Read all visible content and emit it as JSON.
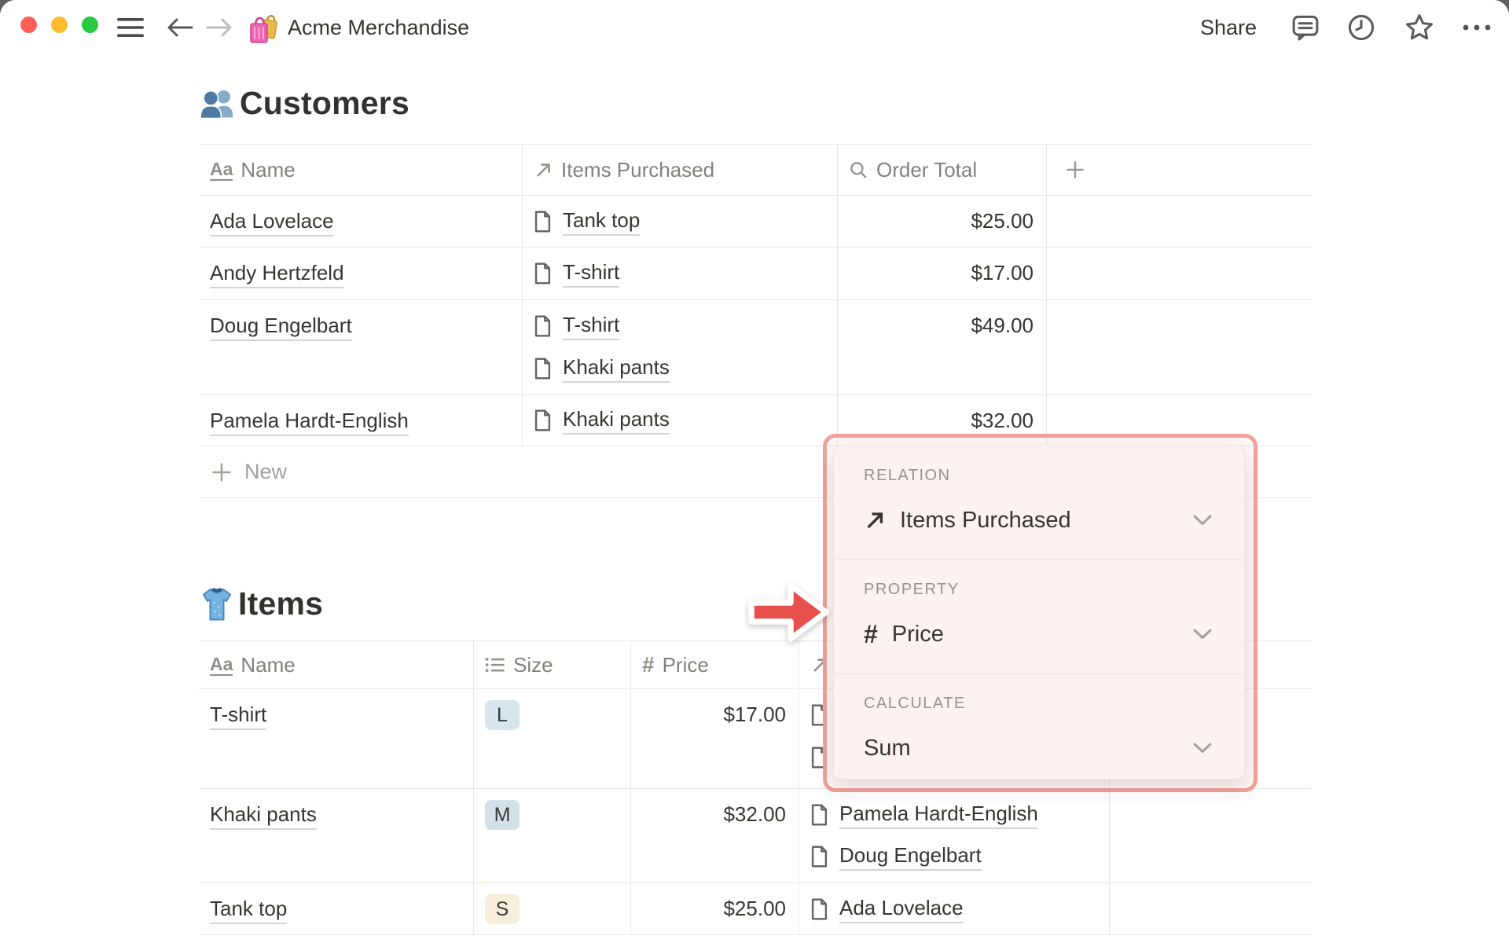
{
  "window": {
    "title": "Acme Merchandise",
    "share_label": "Share"
  },
  "customers": {
    "heading": "Customers",
    "columns": [
      {
        "icon": "title-icon",
        "label": "Name"
      },
      {
        "icon": "relation-icon",
        "label": "Items Purchased"
      },
      {
        "icon": "rollup-icon",
        "label": "Order Total"
      },
      {
        "icon": "plus-icon",
        "label": ""
      }
    ],
    "rows": [
      {
        "name": "Ada Lovelace",
        "items": [
          "Tank top"
        ],
        "order_total": "$25.00"
      },
      {
        "name": "Andy Hertzfeld",
        "items": [
          "T-shirt"
        ],
        "order_total": "$17.00"
      },
      {
        "name": "Doug Engelbart",
        "items": [
          "T-shirt",
          "Khaki pants"
        ],
        "order_total": "$49.00"
      },
      {
        "name": "Pamela Hardt-English",
        "items": [
          "Khaki pants"
        ],
        "order_total": "$32.00"
      }
    ],
    "new_row_label": "New"
  },
  "items": {
    "heading": "Items",
    "columns": [
      {
        "icon": "title-icon",
        "label": "Name"
      },
      {
        "icon": "select-icon",
        "label": "Size"
      },
      {
        "icon": "number-icon",
        "label": "Price"
      },
      {
        "icon": "relation-icon",
        "label": ""
      },
      {
        "icon": "",
        "label": ""
      }
    ],
    "rows": [
      {
        "name": "T-shirt",
        "size": "L",
        "size_bg": "#d7e5ec",
        "price": "$17.00",
        "customers": [
          "",
          ""
        ]
      },
      {
        "name": "Khaki pants",
        "size": "M",
        "size_bg": "#d2e0e8",
        "price": "$32.00",
        "customers": [
          "Pamela Hardt-English",
          "Doug Engelbart"
        ]
      },
      {
        "name": "Tank top",
        "size": "S",
        "size_bg": "#f7eedb",
        "price": "$25.00",
        "customers": [
          "Ada Lovelace"
        ]
      }
    ]
  },
  "popup": {
    "sections": [
      {
        "label": "RELATION",
        "value": "Items Purchased",
        "icon": "relation-icon"
      },
      {
        "label": "PROPERTY",
        "value": "Price",
        "icon": "number-icon"
      },
      {
        "label": "CALCULATE",
        "value": "Sum",
        "icon": ""
      }
    ]
  },
  "colors": {
    "annotation_border": "#f0a29b",
    "annotation_arrow": "#e6514e",
    "popup_background": "#fcf2f0",
    "table_border": "#e9e8e4",
    "header_text": "#83817b",
    "body_text": "#37352f",
    "tag_blue_l": "#d7e5ec",
    "tag_blue_m": "#d2e0e8",
    "tag_yellow_s": "#f7eedb",
    "traffic_red": "#ff5f57",
    "traffic_yellow": "#febc2e",
    "traffic_green": "#28c840"
  }
}
